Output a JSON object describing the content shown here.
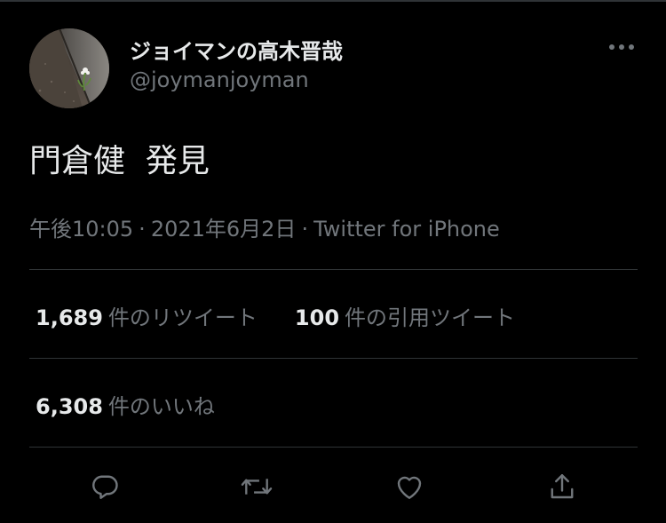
{
  "tweet": {
    "display_name": "ジョイマンの高木晋哉",
    "handle": "@joymanjoyman",
    "text": "門倉健  発見",
    "time": "午後10:05",
    "separator": "·",
    "date": "2021年6月2日",
    "source": "Twitter for iPhone"
  },
  "stats": {
    "retweets": {
      "count": "1,689",
      "label": "件のリツイート"
    },
    "quotes": {
      "count": "100",
      "label": "件の引用ツイート"
    },
    "likes": {
      "count": "6,308",
      "label": "件のいいね"
    }
  },
  "icons": {
    "more": "more-horizontal-icon",
    "reply": "reply-icon",
    "retweet": "retweet-icon",
    "like": "heart-icon",
    "share": "share-icon"
  },
  "colors": {
    "background": "#000000",
    "primary_text": "#e7e9ea",
    "secondary_text": "#71767b",
    "divider": "#2f3336"
  }
}
